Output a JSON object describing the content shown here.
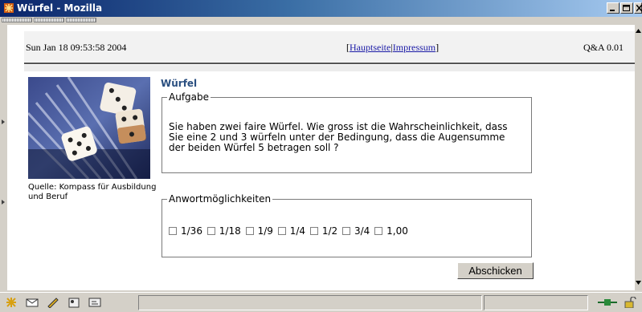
{
  "window": {
    "title": "Würfel - Mozilla"
  },
  "header": {
    "date": "Sun Jan 18 09:53:58 2004",
    "bracket_open": "[",
    "link_home": "Hauptseite",
    "separator": "|",
    "link_imprint": "Impressum",
    "bracket_close": "]",
    "version": "Q&A 0.01"
  },
  "sidebar": {
    "image_icon": "dice-photo",
    "source": "Quelle: Kompass für Ausbildung und Beruf"
  },
  "main": {
    "heading": "Würfel",
    "task_legend": "Aufgabe",
    "task_text": "Sie haben zwei faire Würfel. Wie gross ist die Wahrscheinlichkeit, dass Sie eine 2 und 3 würfeln unter der Bedingung, dass die Augensumme der beiden Würfel 5 betragen soll ?",
    "answers_legend": "Anwortmöglichkeiten",
    "options": [
      "1/36",
      "1/18",
      "1/9",
      "1/4",
      "1/2",
      "3/4",
      "1,00"
    ],
    "submit_label": "Abschicken"
  },
  "statusbar": {
    "icons": [
      "mozilla-icon",
      "mail-icon",
      "composer-icon",
      "addressbook-icon",
      "irc-icon"
    ],
    "connection_icon": "online-plug-icon",
    "security_icon": "padlock-open-icon"
  },
  "colors": {
    "title_gradient_start": "#0a246a",
    "link": "#1a1aa6",
    "heading": "#2a4f80"
  }
}
